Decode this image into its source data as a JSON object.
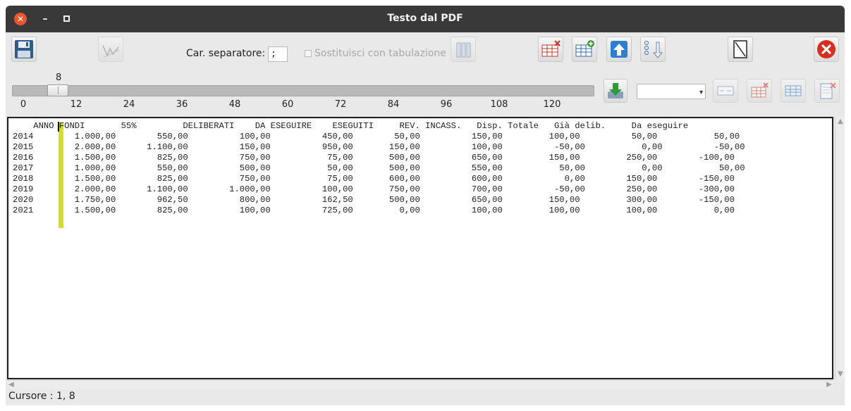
{
  "window": {
    "title": "Testo dal PDF"
  },
  "toolbar": {
    "separator_label": "Car. separatore:",
    "separator_value": ";",
    "tab_option_label": "Sostituisci con tabulazione"
  },
  "slider": {
    "value": "8",
    "ticks": [
      "0",
      "12",
      "24",
      "36",
      "48",
      "60",
      "72",
      "84",
      "96",
      "108",
      "120"
    ]
  },
  "text_lines": [
    "    ANNO FONDI       55%         DELIBERATI    DA ESEGUIRE    ESEGUITI     REV. INCASS.   Disp. Totale   Già delib.     Da eseguire",
    "2014        1.000,00        550,00          100,00          450,00        50,00          150,00         100,00          50,00           50,00",
    "2015        2.000,00      1.100,00          150,00          950,00       150,00          100,00          -50,00           0,00          -50,00",
    "2016        1.500,00        825,00          750,00           75,00       500,00          650,00         150,00         250,00        -100,00",
    "2017        1.000,00        550,00          500,00           50,00       500,00          550,00           50,00           0,00           50,00",
    "2018        1.500,00        825,00          750,00           75,00       600,00          600,00            0,00        150,00        -150,00",
    "2019        2.000,00      1.100,00        1.000,00          100,00       750,00          700,00          -50,00        250,00        -300,00",
    "2020        1.750,00        962,50          800,00          162,50       500,00          650,00         150,00         300,00        -150,00",
    "2021        1.500,00        825,00          100,00          725,00         0,00          100,00         100,00         100,00           0,00"
  ],
  "status": {
    "cursor": "Cursore : 1, 8"
  },
  "colors": {
    "titlebar": "#393939",
    "close": "#e9572e",
    "marker": "#d2e021"
  }
}
